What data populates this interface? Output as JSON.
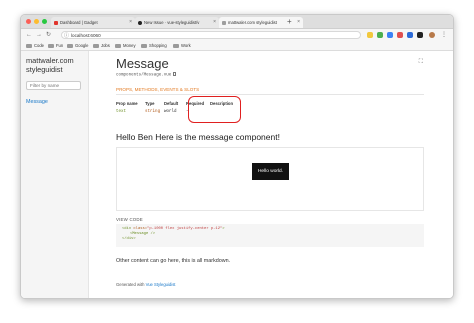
{
  "browser": {
    "tabs": [
      {
        "title": "Dashboard | Gadget",
        "favicon_color": "#e0342c",
        "active": false
      },
      {
        "title": "New Issue · vue-styleguidist/v",
        "favicon_color": "#222222",
        "active": false
      },
      {
        "title": "mattwaler.com styleguidist",
        "favicon_color": "#9e9e9e",
        "active": true
      }
    ],
    "url": "localhost:6060",
    "bookmarks": [
      "Code",
      "Fun",
      "Google",
      "Jobs",
      "Money",
      "Shopping",
      "Work"
    ],
    "colors": {
      "close": "#fc5f57",
      "minimize": "#fdbc2e",
      "maximize": "#28c840"
    }
  },
  "sidebar": {
    "brand": "mattwaler.com styleguidist",
    "filter_placeholder": "Filter by name",
    "items": [
      {
        "label": "Message"
      }
    ]
  },
  "main": {
    "title": "Message",
    "path": "components/Message.vue",
    "section_tab": "PROPS, METHODS, EVENTS & SLOTS",
    "table": {
      "headers": [
        "Prop name",
        "Type",
        "Default",
        "Required",
        "Description"
      ],
      "rows": [
        {
          "prop": "text",
          "type": "string",
          "default": "world",
          "required": "-",
          "description": ""
        }
      ]
    },
    "heading": "Hello Ben Here is the message component!",
    "preview_text": "Hello world.",
    "view_code": "VIEW CODE",
    "code": {
      "line1_tag": "<div",
      "line1_attr": " class=",
      "line1_value": "\"p-1000 flex justify-center p-12\"",
      "line1_end": ">",
      "line2": "<Message />",
      "line3": "</div>"
    },
    "other_text": "Other content can go here, this is all markdown.",
    "footer_prefix": "Generated with",
    "footer_link": "Vue Styleguidist"
  },
  "colors": {
    "accent": "#e37b23",
    "link": "#1978c8",
    "highlight": "#e02020",
    "preview_bg": "#111111"
  }
}
